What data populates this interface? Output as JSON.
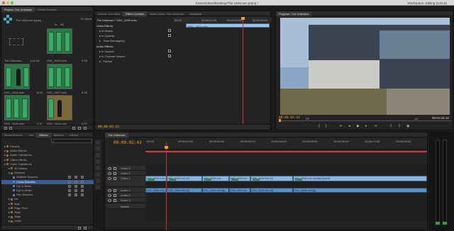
{
  "window": {
    "title": "/Users/robert/Desktop/The Unknown.prproj *",
    "workspace_label": "Workspace:",
    "workspace_value": "Editing (CS5.5)"
  },
  "project_panel": {
    "tabs": [
      "Project: The Unknown",
      "Media Browser"
    ],
    "file_name": "The Unknown.prproj",
    "item_count": "91 Items",
    "in_label": "In:",
    "in_value": "All",
    "items": [
      {
        "name": "The Unknown",
        "duration": "1;14;18"
      },
      {
        "name": "DSC_0025.m4v",
        "duration": "5:18"
      },
      {
        "name": "DSC_0006.m4v",
        "duration": "8:23"
      },
      {
        "name": "DSC_0007.m4v",
        "duration": "5:18"
      },
      {
        "name": "DSC_0028.m4v",
        "duration": "3:11"
      },
      {
        "name": "DSC_0011.m4v",
        "duration": "6:07"
      }
    ]
  },
  "effects_panel": {
    "tabs": [
      "Media Browser",
      "Info",
      "Effects",
      "Markers",
      "History"
    ],
    "items": [
      {
        "label": "Presets",
        "indent": 0
      },
      {
        "label": "Audio Effects",
        "indent": 0
      },
      {
        "label": "Audio Transitions",
        "indent": 0
      },
      {
        "label": "Video Effects",
        "indent": 0
      },
      {
        "label": "Video Transitions",
        "indent": 0
      },
      {
        "label": "3D Motion",
        "indent": 1
      },
      {
        "label": "Dissolve",
        "indent": 1
      },
      {
        "label": "Additive Dissolve",
        "indent": 2
      },
      {
        "label": "Cross Dissolve",
        "indent": 2
      },
      {
        "label": "Dip to Black",
        "indent": 2
      },
      {
        "label": "Dip to White",
        "indent": 2
      },
      {
        "label": "Film Dissolve",
        "indent": 2
      },
      {
        "label": "Iris",
        "indent": 1
      },
      {
        "label": "Map",
        "indent": 1
      },
      {
        "label": "Page Peel",
        "indent": 1
      },
      {
        "label": "Slide",
        "indent": 1
      },
      {
        "label": "Wipe",
        "indent": 1
      },
      {
        "label": "Zoom",
        "indent": 1
      }
    ],
    "selected_index": 8
  },
  "effect_controls": {
    "tabs": [
      "Source: (no clips)",
      "Effect Controls",
      "Audio Mixer: The Unknown",
      "Metadata"
    ],
    "clip_path": "The Unknown * DSC_0000.m4v",
    "ruler_start": "00:00",
    "ruler_marks": [
      "00:00:01:00",
      "00:00:02:00",
      "00:00:03:00"
    ],
    "clip_bar_label": "DSC_0000.m4v",
    "rows": [
      {
        "label": "Video Effects",
        "kind": "head"
      },
      {
        "label": "Motion",
        "kind": "item"
      },
      {
        "label": "Opacity",
        "kind": "item"
      },
      {
        "label": "Time Remapping",
        "kind": "item"
      },
      {
        "label": "Audio Effects",
        "kind": "head"
      },
      {
        "label": "Volume",
        "kind": "item"
      },
      {
        "label": "Channel Volume",
        "kind": "item"
      },
      {
        "label": "Panner",
        "kind": "item"
      }
    ],
    "timecode": "00:00:02:43"
  },
  "program_monitor": {
    "tab": "Program: The Unknown",
    "timecode": "00:00:02:43",
    "fit_label": "Fit",
    "page": "1/2",
    "duration": "00:01:04:18"
  },
  "timeline": {
    "tab": "The Unknown",
    "timecode": "00:00:02:43",
    "ruler": [
      "00:00",
      "00:00:01:00",
      "00:00:02:00",
      "00:00:03:00",
      "00:00:04:00",
      "00:00:05:00",
      "00:00:06:00",
      "00:00:07:00",
      "00:00:08:00"
    ],
    "tracks": [
      "Video 3",
      "Video 2",
      "Video 1",
      "Audio 1",
      "Audio 2",
      "Audio 3",
      "Master"
    ],
    "video_clips": [
      "DSC_0000.m4v [V] Opacity",
      "DSC_0026.m4v [V]",
      "DSC_0025.m4v",
      "DSC_0021.m4",
      "DSC_0016.m4v [V]",
      "DSC_0018.m4v Opacity:Opacity"
    ],
    "audio_clips": [
      "DSC_0000.m4v [A]",
      "DSC_0026.m4v [A]",
      "DSC_0025.m4v [A]",
      "DSC_0021.m4",
      "DSC_0016.m4v [A]",
      "DSC_0018.m4v [A]"
    ]
  },
  "colors": {
    "timecode": "#f0a020",
    "playhead": "#d03030",
    "selection": "#3a5d8c",
    "video_clip": "#8bb4d8",
    "audio_clip": "#5a8fc2"
  }
}
